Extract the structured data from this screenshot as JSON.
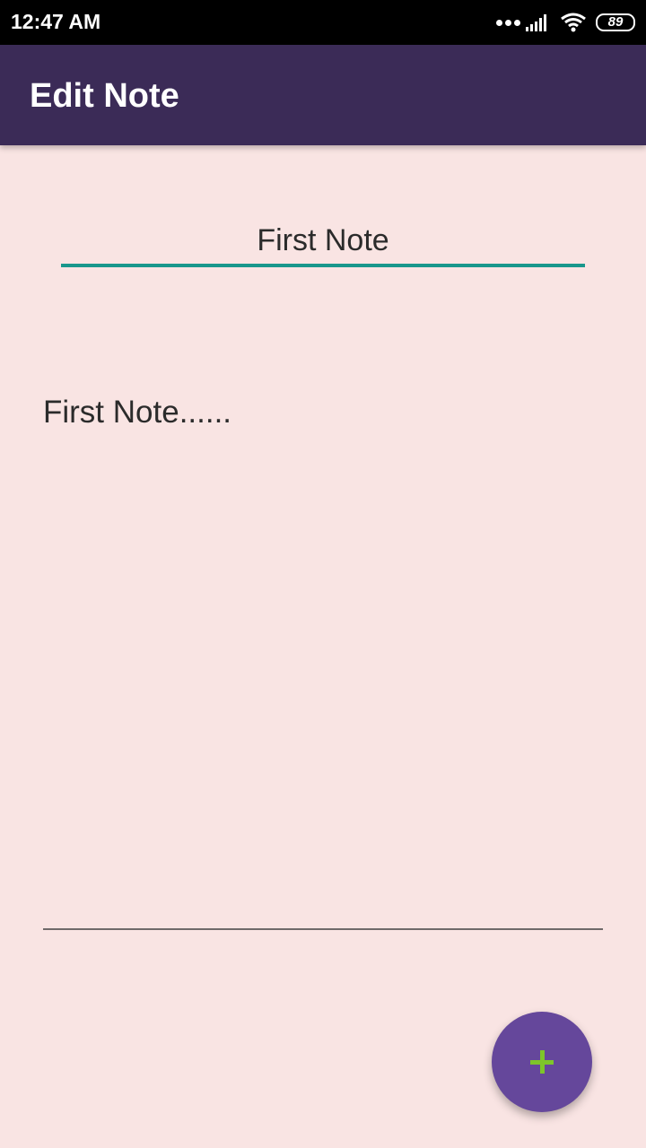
{
  "status_bar": {
    "time": "12:47 AM",
    "battery_level": "89",
    "icons": [
      "more-dots-icon",
      "signal-icon",
      "wifi-icon",
      "battery-icon"
    ]
  },
  "app_bar": {
    "title": "Edit Note"
  },
  "note": {
    "title_value": "First Note",
    "body_value": "First Note......"
  },
  "fab": {
    "icon": "plus-icon"
  },
  "colors": {
    "app_bar": "#3b2b57",
    "background": "#f9e4e3",
    "accent_underline": "#19978c",
    "fab": "#65479b",
    "fab_icon": "#7ec52a"
  }
}
